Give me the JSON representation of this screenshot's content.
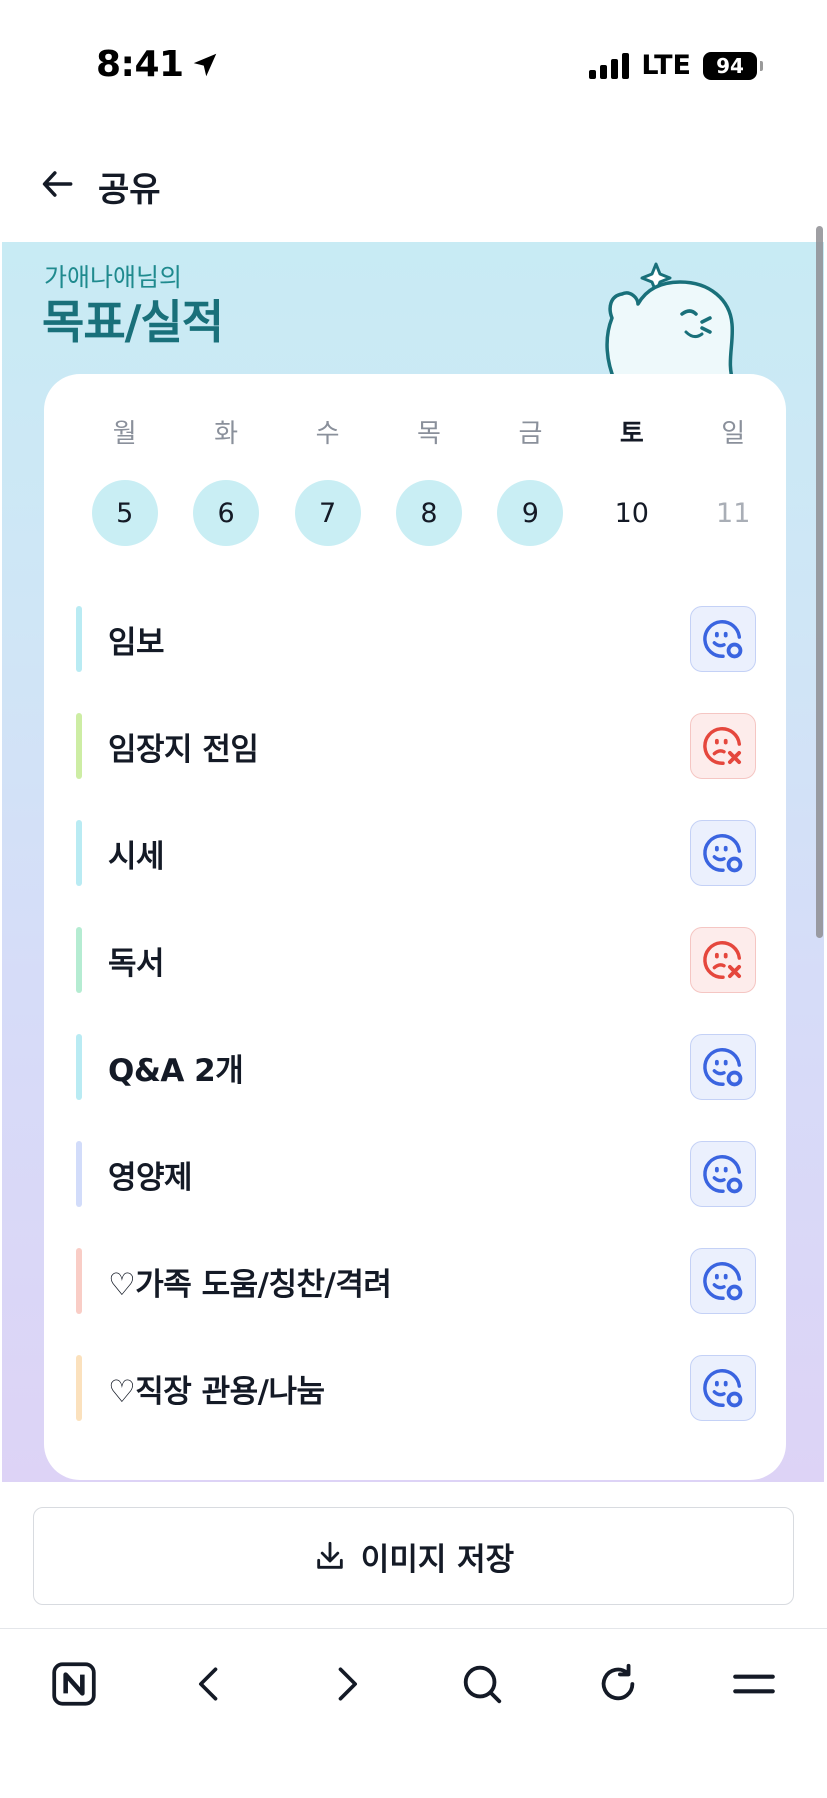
{
  "status_bar": {
    "time": "8:41",
    "network": "LTE",
    "battery": "94"
  },
  "header": {
    "title": "공유"
  },
  "share": {
    "owner": "가애나애님의",
    "title": "목표/실적",
    "week": [
      {
        "day": "월",
        "date": "5",
        "state": "done"
      },
      {
        "day": "화",
        "date": "6",
        "state": "done"
      },
      {
        "day": "수",
        "date": "7",
        "state": "done"
      },
      {
        "day": "목",
        "date": "8",
        "state": "done"
      },
      {
        "day": "금",
        "date": "9",
        "state": "done"
      },
      {
        "day": "토",
        "date": "10",
        "state": "today"
      },
      {
        "day": "일",
        "date": "11",
        "state": "future"
      }
    ],
    "goals": [
      {
        "label": "임보",
        "color": "#b9ebf3",
        "status": "good"
      },
      {
        "label": "임장지 전임",
        "color": "#cdeda4",
        "status": "bad"
      },
      {
        "label": "시세",
        "color": "#b9ebf3",
        "status": "good"
      },
      {
        "label": "독서",
        "color": "#b5ecd2",
        "status": "bad"
      },
      {
        "label": "Q&A 2개",
        "color": "#b9ebf3",
        "status": "good"
      },
      {
        "label": "영양제",
        "color": "#d2dcfa",
        "status": "good"
      },
      {
        "label": "♡가족 도움/칭찬/격려",
        "color": "#f9cdc6",
        "status": "good"
      },
      {
        "label": "♡직장 관용/나눔",
        "color": "#fbe1bd",
        "status": "good"
      }
    ]
  },
  "save_button": {
    "label": "이미지 저장"
  },
  "colors": {
    "accent_teal": "#19707a",
    "good": "#3a64e0",
    "bad": "#e5473d"
  },
  "toolbar": {
    "items": [
      "naver-home-icon",
      "back-arrow-icon",
      "forward-arrow-icon",
      "search-icon",
      "refresh-icon",
      "menu-icon"
    ]
  }
}
